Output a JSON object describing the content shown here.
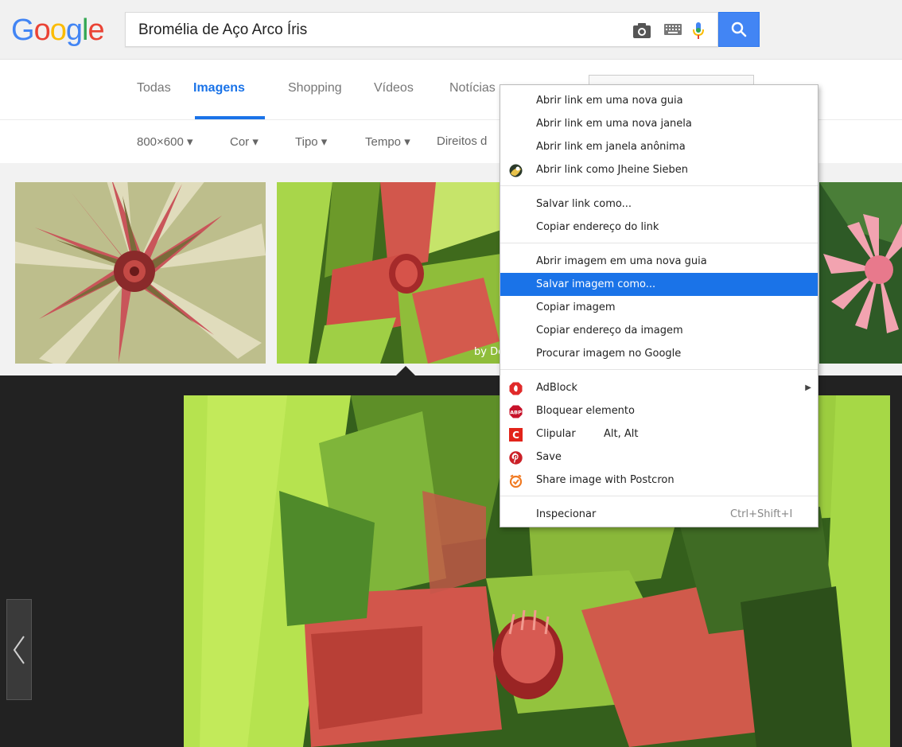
{
  "header": {
    "logo_letters": [
      "G",
      "o",
      "o",
      "g",
      "l",
      "e"
    ],
    "logo_colors": [
      "#4285f4",
      "#ea4335",
      "#fbbc05",
      "#4285f4",
      "#34a853",
      "#ea4335"
    ],
    "search_query": "Bromélia de Aço Arco Íris"
  },
  "tabs": {
    "items": [
      "Todas",
      "Imagens",
      "Shopping",
      "Vídeos",
      "Notícias"
    ],
    "active": "Imagens"
  },
  "filters": {
    "items": [
      "800×600 ▾",
      "Cor ▾",
      "Tipo ▾",
      "Tempo ▾",
      "Direitos d"
    ]
  },
  "thumbnails": {
    "caption_2": "by De"
  },
  "context_menu": {
    "group1": [
      "Abrir link em uma nova guia",
      "Abrir link em uma nova janela",
      "Abrir link em janela anônima",
      "Abrir link como Jheine Sieben"
    ],
    "group2": [
      "Salvar link como...",
      "Copiar endereço do link"
    ],
    "group3": [
      "Abrir imagem em uma nova guia",
      "Salvar imagem como...",
      "Copiar imagem",
      "Copiar endereço da imagem",
      "Procurar imagem no Google"
    ],
    "group4": {
      "adblock": "AdBlock",
      "bloquear": "Bloquear elemento",
      "clipular": "Clipular",
      "clipular_shortcut": "Alt, Alt",
      "save": "Save",
      "postcron": "Share image with Postcron",
      "abp_badge": "ABP",
      "clip_badge": "C"
    },
    "group5": {
      "inspecionar": "Inspecionar",
      "shortcut": "Ctrl+Shift+I"
    },
    "highlighted": "Salvar imagem como...",
    "highlight_color": "#1a73e8"
  }
}
